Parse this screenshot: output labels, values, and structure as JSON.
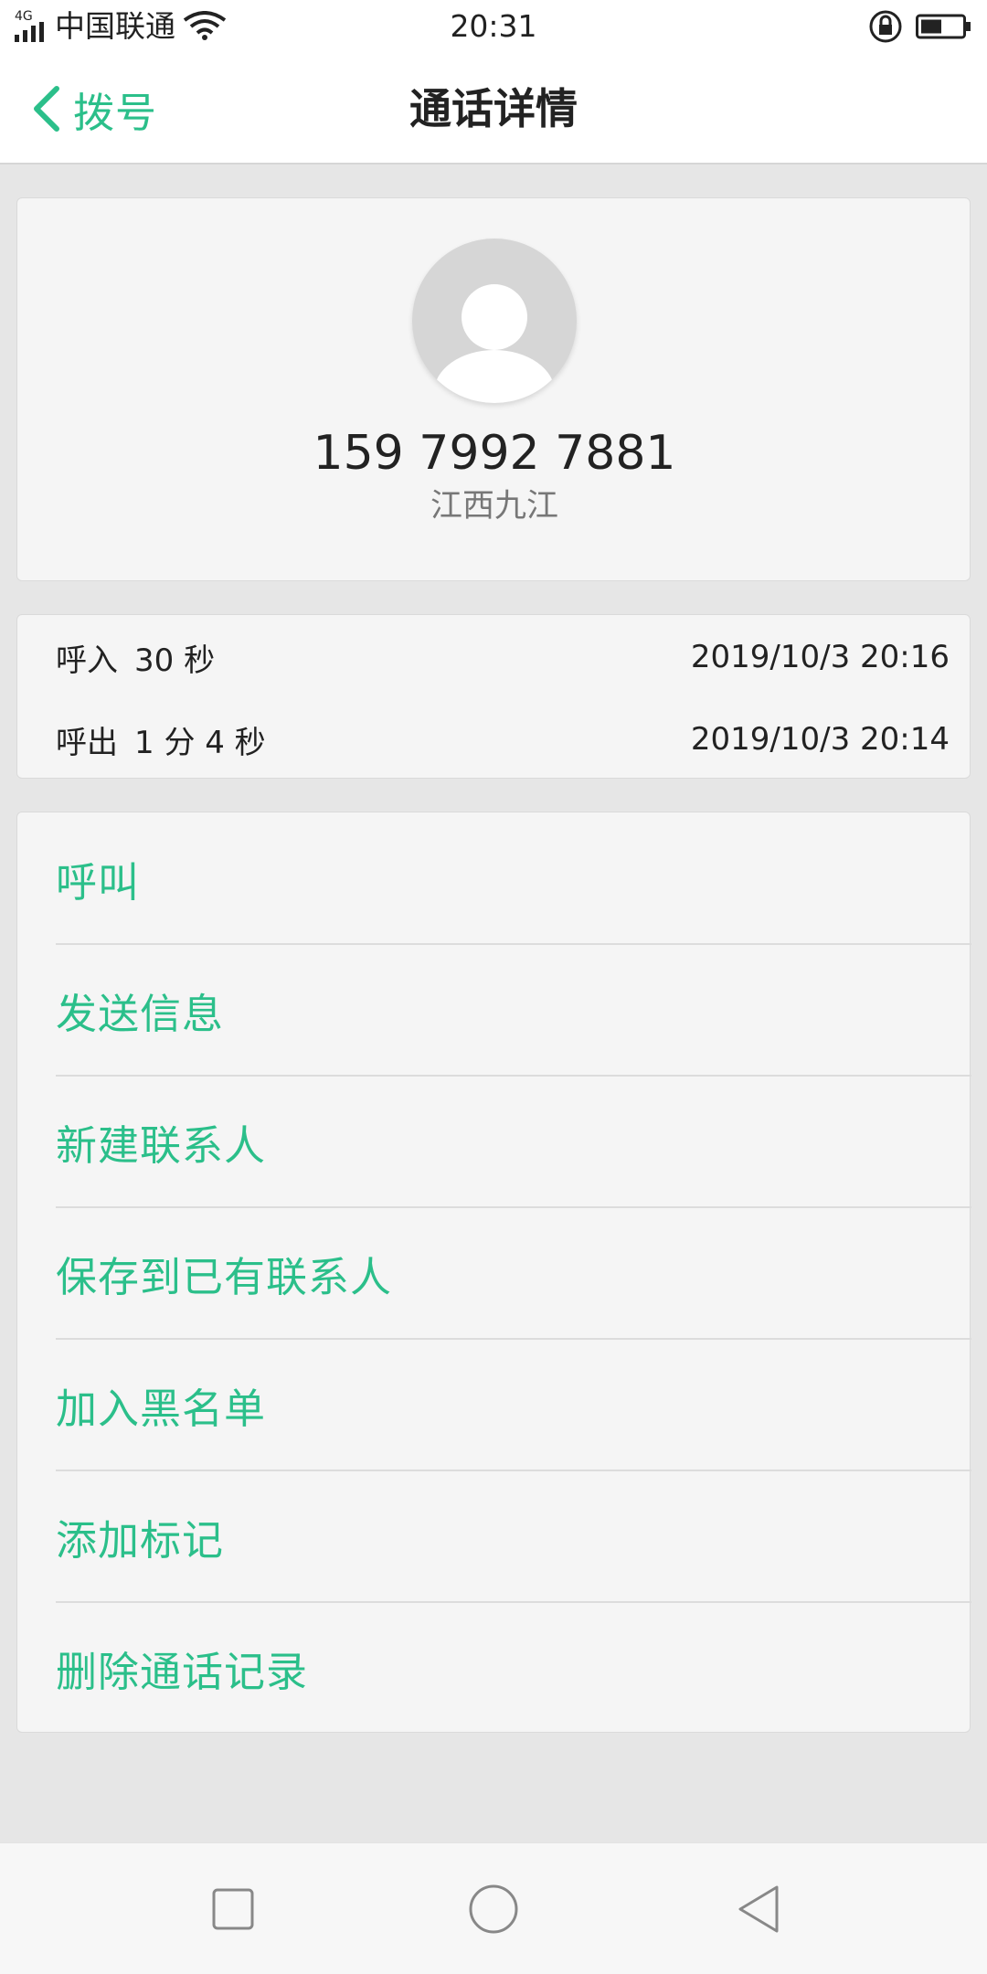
{
  "status_bar": {
    "network_type": "4G",
    "carrier": "中国联通",
    "time": "20:31"
  },
  "header": {
    "back_label": "拨号",
    "title": "通话详情"
  },
  "contact": {
    "phone_number": "159 7992 7881",
    "location": "江西九江"
  },
  "call_log": [
    {
      "type": "呼入",
      "duration": "30 秒",
      "timestamp": "2019/10/3 20:16"
    },
    {
      "type": "呼出",
      "duration": "1 分 4 秒",
      "timestamp": "2019/10/3 20:14"
    }
  ],
  "actions": [
    {
      "label": "呼叫"
    },
    {
      "label": "发送信息"
    },
    {
      "label": "新建联系人"
    },
    {
      "label": "保存到已有联系人"
    },
    {
      "label": "加入黑名单"
    },
    {
      "label": "添加标记"
    },
    {
      "label": "删除通话记录"
    }
  ],
  "colors": {
    "accent": "#2bbf8a",
    "background": "#e6e6e6",
    "card": "#f5f5f5",
    "text": "#222222",
    "secondary_text": "#777777"
  },
  "icons": {
    "back": "chevron-left-icon",
    "avatar": "person-placeholder-icon",
    "nav_recent": "square-icon",
    "nav_home": "circle-icon",
    "nav_back": "triangle-left-icon"
  }
}
